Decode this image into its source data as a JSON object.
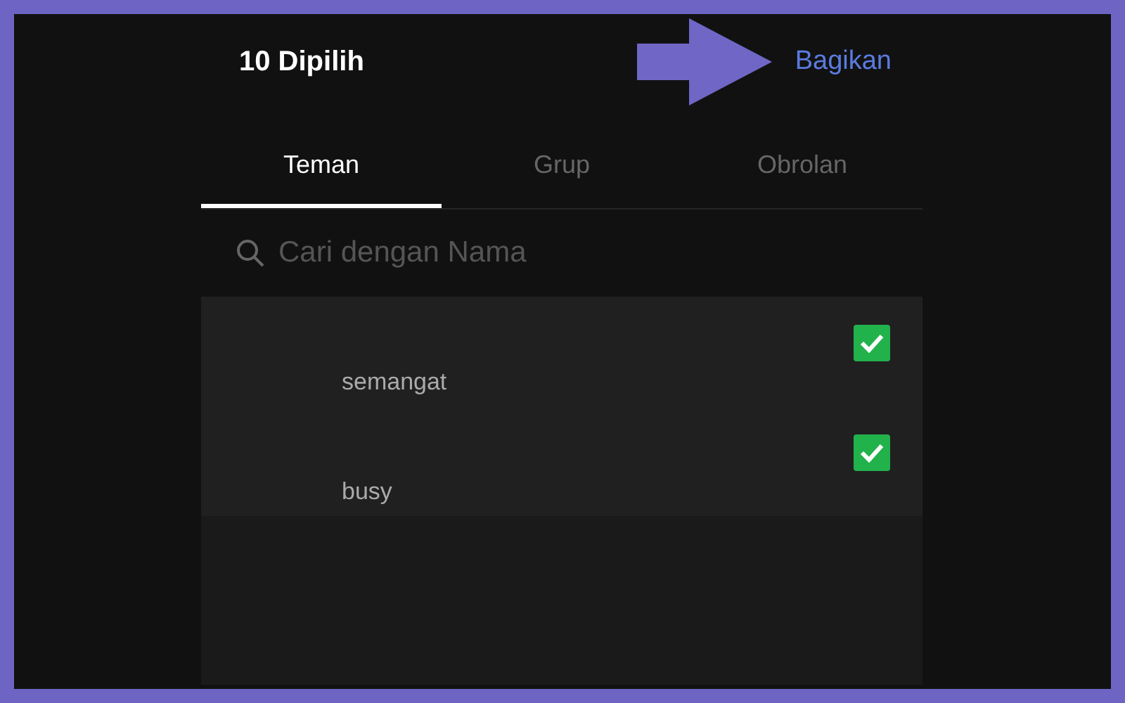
{
  "header": {
    "title": "10 Dipilih",
    "action": "Bagikan"
  },
  "tabs": [
    {
      "label": "Teman",
      "selected": true
    },
    {
      "label": "Grup",
      "selected": false
    },
    {
      "label": "Obrolan",
      "selected": false
    }
  ],
  "search": {
    "placeholder": "Cari dengan Nama"
  },
  "contacts": [
    {
      "name": "semangat",
      "checked": true
    },
    {
      "name": "busy",
      "checked": true
    }
  ]
}
